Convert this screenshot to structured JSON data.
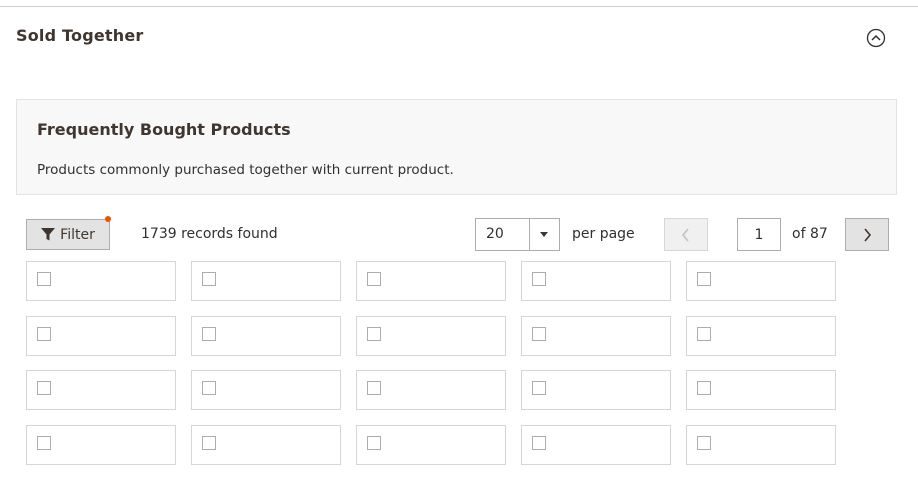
{
  "section": {
    "title": "Sold Together",
    "collapse_icon": "chevron-up-circle-icon"
  },
  "info": {
    "title": "Frequently Bought Products",
    "description": "Products commonly purchased together with current product."
  },
  "toolbar": {
    "filter_label": "Filter",
    "records_text": "1739 records found",
    "per_page_value": "20",
    "per_page_label": "per page",
    "current_page": "1",
    "total_pages_text": "of 87"
  },
  "colors": {
    "accent_dot": "#eb5202",
    "title_text": "#41362f"
  },
  "grid": {
    "rows": 4,
    "columns": 5,
    "checked": [
      [
        false,
        false,
        false,
        false,
        false
      ],
      [
        false,
        false,
        false,
        false,
        false
      ],
      [
        false,
        false,
        false,
        false,
        false
      ],
      [
        false,
        false,
        false,
        false,
        false
      ]
    ]
  }
}
